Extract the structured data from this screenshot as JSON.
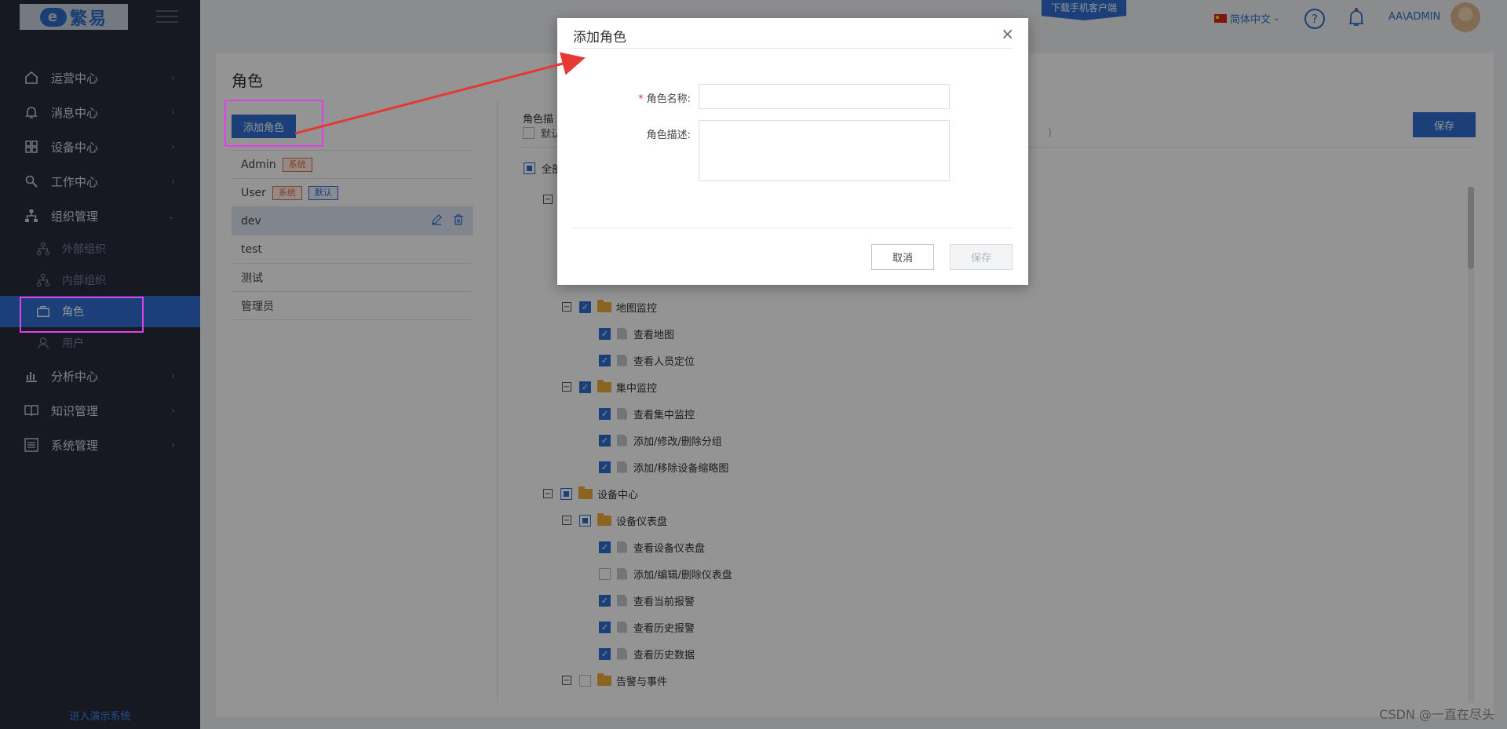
{
  "sidebar": {
    "logo_text": "繁易",
    "logo_mark": "e",
    "nav": [
      {
        "label": "运营中心",
        "icon": "home-icon"
      },
      {
        "label": "消息中心",
        "icon": "bell-icon"
      },
      {
        "label": "设备中心",
        "icon": "grid-icon"
      },
      {
        "label": "工作中心",
        "icon": "wrench-icon"
      },
      {
        "label": "组织管理",
        "icon": "org-icon"
      }
    ],
    "org_sub": [
      {
        "label": "外部组织",
        "icon": "org-small-icon"
      },
      {
        "label": "内部组织",
        "icon": "org-small-icon"
      },
      {
        "label": "角色",
        "icon": "briefcase-icon"
      },
      {
        "label": "用户",
        "icon": "user-icon"
      }
    ],
    "nav_bottom": [
      {
        "label": "分析中心",
        "icon": "chart-icon"
      },
      {
        "label": "知识管理",
        "icon": "book-icon"
      },
      {
        "label": "系统管理",
        "icon": "settings-list-icon"
      }
    ],
    "demo_link": "进入演示系统"
  },
  "topbar": {
    "download_badge": "下载手机客户端",
    "language": "简体中文",
    "help_glyph": "?",
    "user": "AA\\ADMIN"
  },
  "page": {
    "title": "角色",
    "add_role_button": "添加角色",
    "roles": [
      {
        "name": "Admin",
        "tags": [
          "系统"
        ]
      },
      {
        "name": "User",
        "tags": [
          "系统",
          "默认"
        ]
      },
      {
        "name": "dev",
        "tags": []
      },
      {
        "name": "test",
        "tags": []
      },
      {
        "name": "测试",
        "tags": []
      },
      {
        "name": "管理员",
        "tags": []
      }
    ],
    "perm_header": "角色描",
    "perm_default": "默认",
    "perm_tail": ")",
    "perm_all": "全部",
    "save_button": "保存",
    "tree": [
      {
        "label": "地图监控",
        "type": "folder",
        "state": "checked"
      },
      {
        "label": "查看地图",
        "type": "file",
        "state": "checked"
      },
      {
        "label": "查看人员定位",
        "type": "file",
        "state": "checked"
      },
      {
        "label": "集中监控",
        "type": "folder",
        "state": "checked"
      },
      {
        "label": "查看集中监控",
        "type": "file",
        "state": "checked"
      },
      {
        "label": "添加/修改/删除分组",
        "type": "file",
        "state": "checked"
      },
      {
        "label": "添加/移除设备缩略图",
        "type": "file",
        "state": "checked"
      },
      {
        "label": "设备中心",
        "type": "folder",
        "state": "partial"
      },
      {
        "label": "设备仪表盘",
        "type": "folder",
        "state": "partial"
      },
      {
        "label": "查看设备仪表盘",
        "type": "file",
        "state": "checked"
      },
      {
        "label": "添加/编辑/删除仪表盘",
        "type": "file",
        "state": "unchecked"
      },
      {
        "label": "查看当前报警",
        "type": "file",
        "state": "checked"
      },
      {
        "label": "查看历史报警",
        "type": "file",
        "state": "checked"
      },
      {
        "label": "查看历史数据",
        "type": "file",
        "state": "checked"
      },
      {
        "label": "告警与事件",
        "type": "folder",
        "state": "unchecked"
      }
    ]
  },
  "modal": {
    "title": "添加角色",
    "close_glyph": "×",
    "required_mark": "*",
    "name_label": "角色名称:",
    "name_value": "",
    "desc_label": "角色描述:",
    "desc_value": "",
    "cancel": "取消",
    "save": "保存"
  },
  "annotation_color": "#e040e8",
  "arrow_color": "#e53935",
  "watermark": "CSDN @一直在尽头"
}
